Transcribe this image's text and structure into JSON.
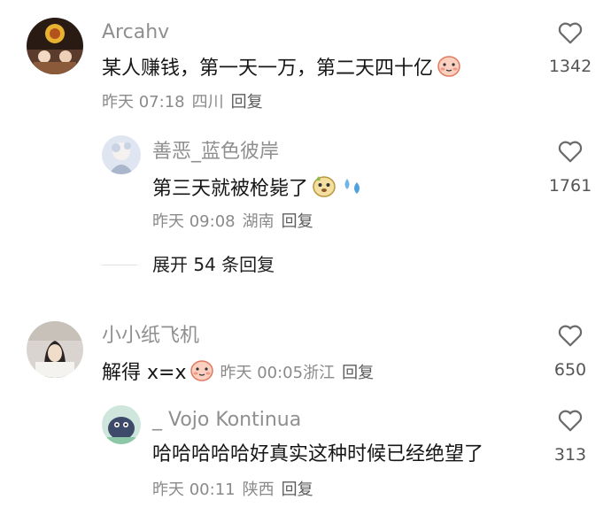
{
  "comments": [
    {
      "username": "Arcahv",
      "text": "某人赚钱，第一天一万，第二天四十亿",
      "emoji": "blush-face-emoji",
      "time": "昨天 07:18",
      "location": "四川",
      "reply_label": "回复",
      "likes": "1342"
    },
    {
      "username": "善恶_蓝色彼岸",
      "text": "第三天就被枪毙了",
      "emoji": "dog-face-emoji",
      "time": "昨天 09:08",
      "location": "湖南",
      "reply_label": "回复",
      "likes": "1761"
    },
    {
      "username": "小小纸飞机",
      "text": "解得 x=x",
      "emoji": "blush-face-emoji",
      "time": "昨天 00:05",
      "location": "浙江",
      "reply_label": "回复",
      "likes": "650"
    },
    {
      "username": "_ Vojo Kontinua",
      "text": "哈哈哈哈哈好真实这种时候已经绝望了",
      "time": "昨天 00:11",
      "location": "陕西",
      "reply_label": "回复",
      "likes": "313"
    }
  ],
  "expand_replies": {
    "label": "展开 54 条回复"
  },
  "colors": {
    "username": "#8f8f8f",
    "text": "#161616",
    "meta": "#8a8a8a",
    "heart_stroke": "#6b6b6b"
  }
}
